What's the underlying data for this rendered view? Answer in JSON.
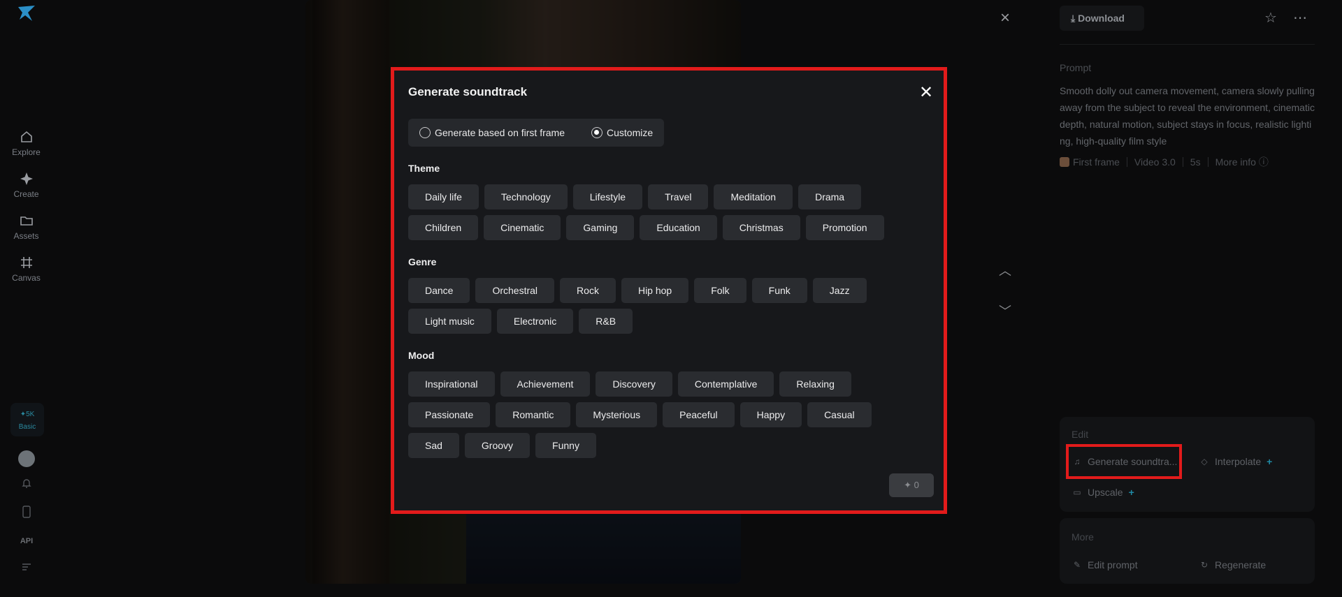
{
  "nav": {
    "items": [
      {
        "label": "Explore",
        "icon": "home-icon"
      },
      {
        "label": "Create",
        "icon": "sparkle-icon"
      },
      {
        "label": "Assets",
        "icon": "folder-icon"
      },
      {
        "label": "Canvas",
        "icon": "canvas-icon"
      }
    ],
    "credits": {
      "amount": "5K",
      "plan": "Basic"
    },
    "api_label": "API"
  },
  "right": {
    "download_label": "Download",
    "prompt_label": "Prompt",
    "prompt_text": "Smooth dolly out camera movement, camera slowly pulling away from the subject to reveal the environment, cinematic depth, natural motion, subject stays in focus, realistic lighting, high-quality film style",
    "meta": {
      "first_frame": "First frame",
      "model": "Video 3.0",
      "duration": "5s",
      "more_info": "More info"
    },
    "edit": {
      "title": "Edit",
      "generate_soundtrack": "Generate soundtra...",
      "interpolate": "Interpolate",
      "upscale": "Upscale"
    },
    "more": {
      "title": "More",
      "edit_prompt": "Edit prompt",
      "regenerate": "Regenerate"
    }
  },
  "dialog": {
    "title": "Generate soundtrack",
    "modes": [
      "Generate based on first frame",
      "Customize"
    ],
    "selected_mode": "Customize",
    "theme_label": "Theme",
    "theme": [
      "Daily life",
      "Technology",
      "Lifestyle",
      "Travel",
      "Meditation",
      "Drama",
      "Children",
      "Cinematic",
      "Gaming",
      "Education",
      "Christmas",
      "Promotion"
    ],
    "genre_label": "Genre",
    "genre": [
      "Dance",
      "Orchestral",
      "Rock",
      "Hip hop",
      "Folk",
      "Funk",
      "Jazz",
      "Light music",
      "Electronic",
      "R&B"
    ],
    "mood_label": "Mood",
    "mood": [
      "Inspirational",
      "Achievement",
      "Discovery",
      "Contemplative",
      "Relaxing",
      "Passionate",
      "Romantic",
      "Mysterious",
      "Peaceful",
      "Happy",
      "Casual",
      "Sad",
      "Groovy",
      "Funny"
    ],
    "submit_cost": "0"
  },
  "colors": {
    "highlight": "#e21b1b",
    "accent": "#1f8aa5"
  }
}
